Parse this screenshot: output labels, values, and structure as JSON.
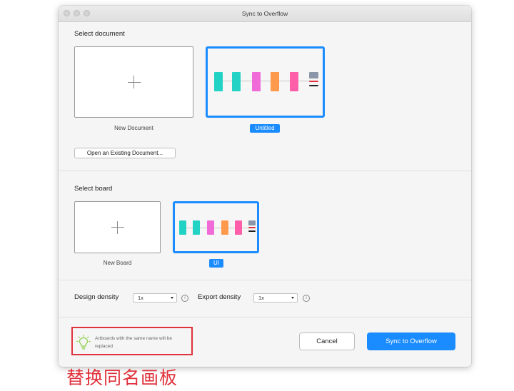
{
  "window": {
    "title": "Sync to Overflow"
  },
  "select_document": {
    "title": "Select document",
    "new_label": "New Document",
    "selected_label": "Untitled",
    "open_button": "Open an Existing Document..."
  },
  "select_board": {
    "title": "Select board",
    "new_label": "New Board",
    "selected_label": "UI"
  },
  "density": {
    "design_label": "Design density",
    "design_value": "1x",
    "export_label": "Export density",
    "export_value": "1x",
    "info_glyph": "i"
  },
  "footer": {
    "hint": "Artboards with the same name will be replaced",
    "cancel": "Cancel",
    "sync": "Sync to Overflow"
  },
  "annotation": "替换同名画板",
  "colors": {
    "accent": "#1a8cff",
    "highlight_red": "#e0323c",
    "teal": "#22d3c5",
    "magenta": "#f06bd8",
    "orange": "#ff9a4d",
    "pink": "#ff5fa8"
  },
  "icons": [
    "plus-icon",
    "chevron-down-icon",
    "info-icon",
    "lightbulb-icon"
  ]
}
